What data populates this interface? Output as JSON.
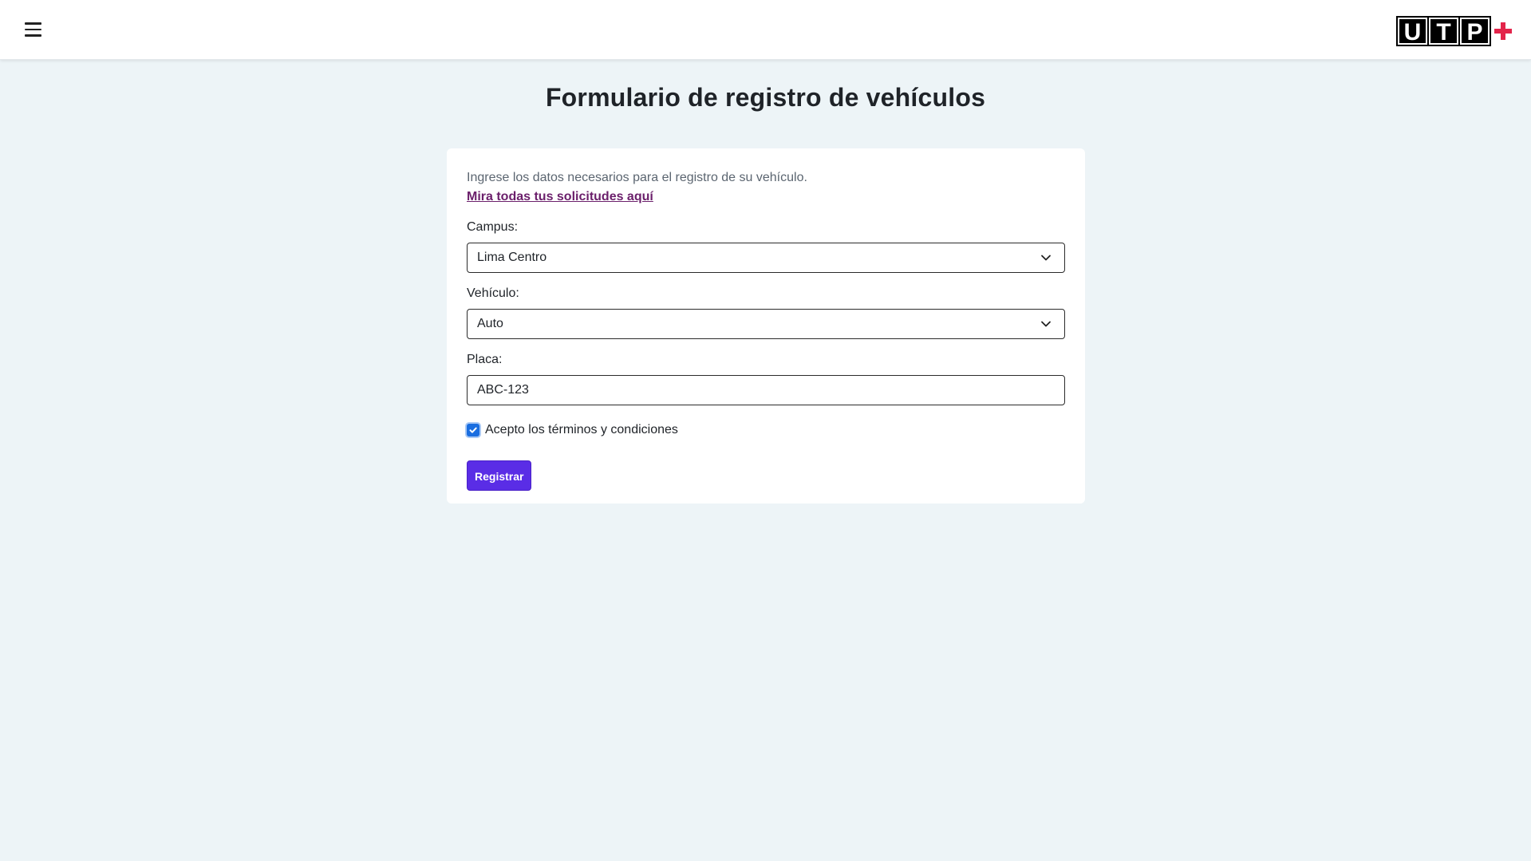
{
  "header": {
    "menu_icon": "hamburger-menu-icon",
    "logo": {
      "letters": [
        "U",
        "T",
        "P"
      ],
      "plus_color": "#e3244a"
    }
  },
  "page": {
    "title": "Formulario de registro de vehículos"
  },
  "form": {
    "intro": "Ingrese los datos necesarios para el registro de su vehículo.",
    "requests_link": "Mira todas tus solicitudes aquí",
    "campus": {
      "label": "Campus:",
      "value": "Lima Centro"
    },
    "vehicle": {
      "label": "Vehículo:",
      "value": "Auto"
    },
    "plate": {
      "label": "Placa:",
      "value": "ABC-123"
    },
    "terms": {
      "label": "Acepto los términos y condiciones",
      "checked": true
    },
    "submit_label": "Registrar"
  },
  "colors": {
    "background": "#edf4f7",
    "primary_button": "#5a2de6",
    "link": "#6b1f6b",
    "checkbox": "#1a6ee0"
  }
}
